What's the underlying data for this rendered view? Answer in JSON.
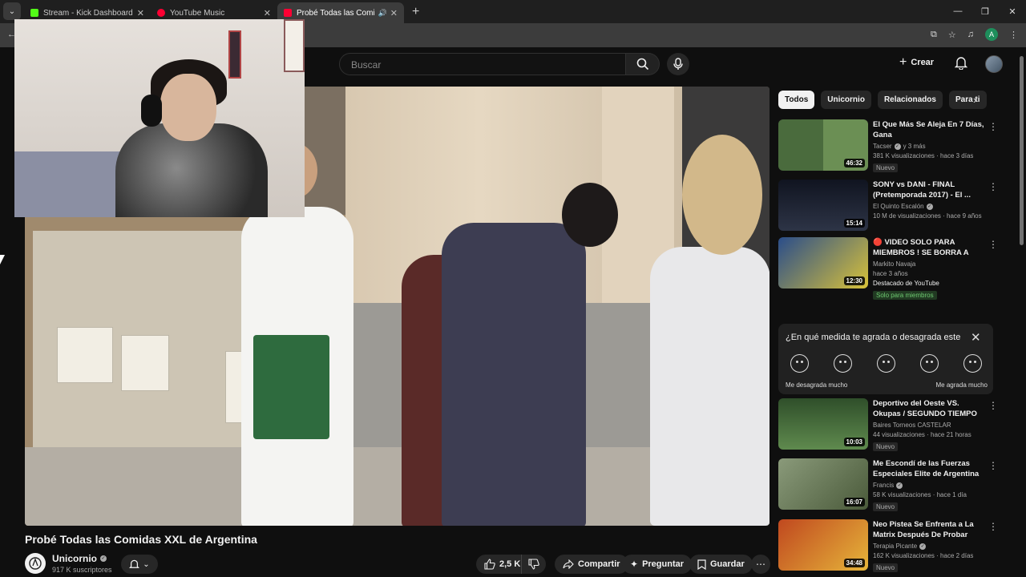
{
  "browser": {
    "tabs": [
      {
        "title": "Stream - Kick Dashboard",
        "color": "#53fc18",
        "active": false
      },
      {
        "title": "YouTube Music",
        "color": "#ff0033",
        "active": false
      },
      {
        "title": "Probé Todas las Comidas XXL",
        "color": "#ff0033",
        "active": true
      }
    ],
    "profile_letter": "A"
  },
  "header": {
    "search_placeholder": "Buscar",
    "create_label": "Crear"
  },
  "video": {
    "title": "Probé Todas las Comidas XXL de Argentina",
    "channel": "Unicornio",
    "subscribers": "917 K suscriptores",
    "likes": "2,5 K",
    "share_label": "Compartir",
    "ask_label": "Preguntar",
    "save_label": "Guardar"
  },
  "sidebar": {
    "chips": [
      "Todos",
      "Unicornio",
      "Relacionados",
      "Para ti"
    ],
    "recommendations": [
      {
        "title": "El Que Más Se Aleja En 7 Días, Gana",
        "channel": "Tacser",
        "extra": "y 3 más",
        "meta": "381 K visualizaciones · hace 3 días",
        "badge": "Nuevo",
        "duration": "46:32",
        "thumb": "#4a6b3d"
      },
      {
        "title": "SONY vs DANI - FINAL (Pretemporada 2017) - El ...",
        "channel": "El Quinto Escalón",
        "meta": "10 M de visualizaciones · hace 9 años",
        "duration": "15:14",
        "thumb": "#1b2130"
      },
      {
        "title": "🔴 VIDEO SOLO PARA MIEMBROS ! SE BORRA A LAS...",
        "channel": "Markito Navaja",
        "meta": "hace 3 años",
        "line2": "Destacado de YouTube",
        "badge": "Solo para miembros",
        "duration": "12:30",
        "thumb": "#2a4d8a"
      },
      {
        "title": "Deportivo del Oeste VS. Okupas / SEGUNDO TIEMPO ...",
        "channel": "Baires Torneos CASTELAR",
        "meta": "44 visualizaciones · hace 21 horas",
        "badge": "Nuevo",
        "duration": "10:03",
        "thumb": "#3f6a40"
      },
      {
        "title": "Me Escondí de las Fuerzas Especiales Elite de Argentina",
        "channel": "Francis",
        "meta": "58 K visualizaciones · hace 1 día",
        "badge": "Nuevo",
        "duration": "16:07",
        "thumb": "#6b7a55"
      },
      {
        "title": "Neo Pistea Se Enfrenta a La Matrix Después De Probar Las...",
        "channel": "Terapia Picante",
        "meta": "162 K visualizaciones · hace 2 días",
        "badge": "Nuevo",
        "duration": "34:48",
        "thumb": "#c0481f"
      }
    ],
    "survey": {
      "question": "¿En qué medida te agrada o desagrada este",
      "low_label": "Me desagrada mucho",
      "high_label": "Me agrada mucho"
    }
  }
}
